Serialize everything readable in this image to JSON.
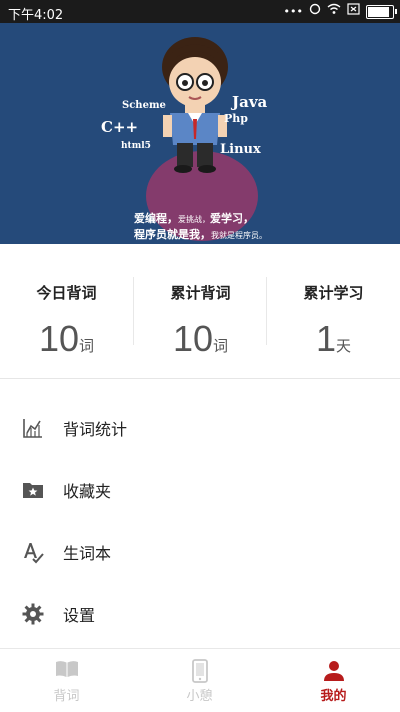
{
  "status_bar": {
    "time": "下午4:02"
  },
  "banner": {
    "words": [
      "Scheme",
      "Java",
      "C++",
      "Php",
      "html5",
      "Linux"
    ],
    "caption_line1_a": "爱编程，",
    "caption_line1_b": "爱挑战，",
    "caption_line1_c": "爱学习，",
    "caption_line2_a": "程序员就是我，",
    "caption_line2_b": "我就是程序员。"
  },
  "stats": [
    {
      "label": "今日背词",
      "value": "10",
      "unit": "词"
    },
    {
      "label": "累计背词",
      "value": "10",
      "unit": "词"
    },
    {
      "label": "累计学习",
      "value": "1",
      "unit": "天"
    }
  ],
  "menu": [
    {
      "label": "背词统计",
      "icon": "chart-icon"
    },
    {
      "label": "收藏夹",
      "icon": "folder-star-icon"
    },
    {
      "label": "生词本",
      "icon": "spellcheck-icon"
    },
    {
      "label": "设置",
      "icon": "gear-icon"
    }
  ],
  "tabs": [
    {
      "label": "背词",
      "icon": "book-icon",
      "active": false
    },
    {
      "label": "小憩",
      "icon": "phone-icon",
      "active": false
    },
    {
      "label": "我的",
      "icon": "person-icon",
      "active": true
    }
  ],
  "colors": {
    "accent": "#b71c1c",
    "banner_bg": "#254a7a",
    "inactive": "#c8c8c8"
  }
}
